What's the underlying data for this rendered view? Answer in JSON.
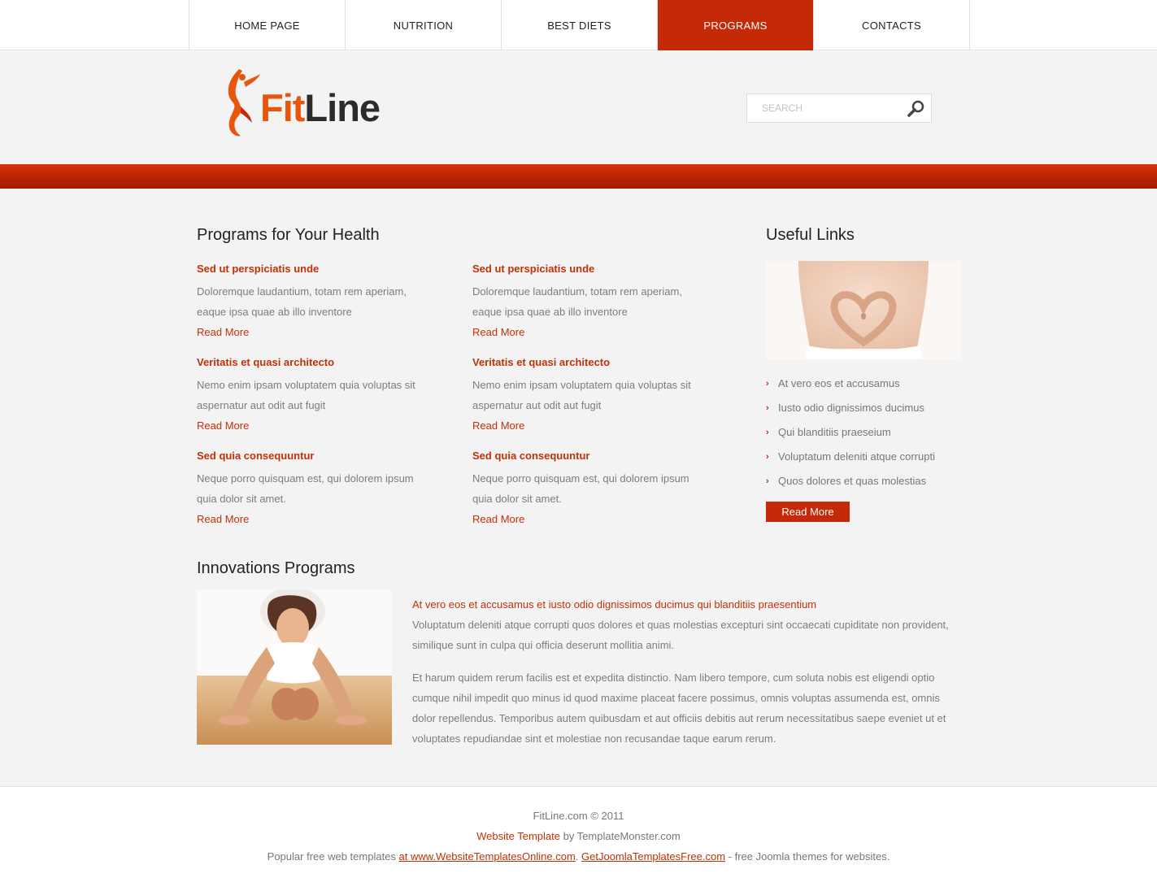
{
  "nav": {
    "items": [
      {
        "label": "HOME PAGE"
      },
      {
        "label": "NUTRITION"
      },
      {
        "label": "BEST DIETS"
      },
      {
        "label": "PROGRAMS"
      },
      {
        "label": "CONTACTS"
      }
    ],
    "active_index": 3
  },
  "header": {
    "logo_fit": "Fit",
    "logo_line": "Line",
    "search_placeholder": "SEARCH"
  },
  "programs": {
    "title": "Programs for Your Health",
    "columns": [
      [
        {
          "title": "Sed ut perspiciatis unde",
          "text": "Doloremque laudantium, totam rem aperiam, eaque ipsa quae ab illo inventore",
          "link": "Read More"
        },
        {
          "title": "Veritatis et quasi architecto",
          "text": "Nemo enim ipsam voluptatem quia voluptas sit aspernatur aut odit aut fugit",
          "link": "Read More"
        },
        {
          "title": "Sed quia consequuntur",
          "text": "Neque porro quisquam est, qui dolorem ipsum quia dolor sit amet.",
          "link": "Read More"
        }
      ],
      [
        {
          "title": "Sed ut perspiciatis unde",
          "text": "Doloremque laudantium, totam rem aperiam, eaque ipsa quae ab illo inventore",
          "link": "Read More"
        },
        {
          "title": "Veritatis et quasi architecto",
          "text": "Nemo enim ipsam voluptatem quia voluptas sit aspernatur aut odit aut fugit",
          "link": "Read More"
        },
        {
          "title": "Sed quia consequuntur",
          "text": "Neque porro quisquam est, qui dolorem ipsum quia dolor sit amet.",
          "link": "Read More"
        }
      ]
    ]
  },
  "useful_links": {
    "title": "Useful Links",
    "items": [
      "At vero eos et accusamus",
      "Iusto odio dignissimos ducimus",
      "Qui blanditiis praeseium",
      "Voluptatum deleniti atque corrupti",
      "Quos dolores et quas molestias"
    ],
    "button": "Read More"
  },
  "innovations": {
    "title": "Innovations Programs",
    "lead": "At vero eos et accusamus et iusto odio dignissimos ducimus qui blanditiis praesentium",
    "para1": "Voluptatum deleniti atque corrupti quos dolores et quas molestias excepturi sint occaecati cupiditate non provident, similique sunt in culpa qui officia deserunt mollitia animi.",
    "para2": "Et harum quidem rerum facilis est et expedita distinctio. Nam libero tempore, cum soluta nobis est eligendi optio cumque nihil impedit quo minus id quod maxime placeat facere possimus, omnis voluptas assumenda est, omnis dolor repellendus. Temporibus autem quibusdam et aut officiis debitis aut rerum necessitatibus saepe eveniet ut et voluptates repudiandae sint et molestiae non recusandae taque earum rerum."
  },
  "footer": {
    "copyright": "FitLine.com © 2011",
    "template_link": "Website Template",
    "template_by": " by TemplateMonster.com",
    "popular_prefix": "Popular free web templates ",
    "link1": "at www.WebsiteTemplatesOnline.com",
    "sep": ". ",
    "link2": "GetJoomlaTemplatesFree.com",
    "suffix": " - free Joomla themes for websites."
  },
  "colors": {
    "accent": "#c42a07",
    "logo_orange": "#e8560c"
  }
}
